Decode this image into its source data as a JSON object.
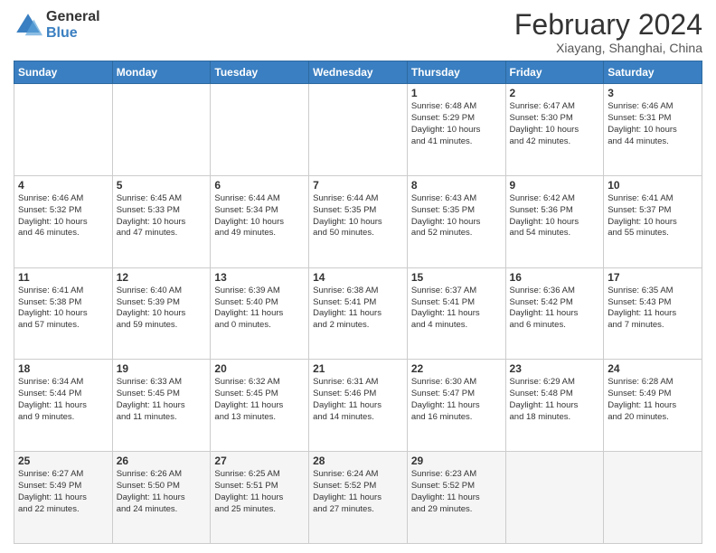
{
  "logo": {
    "general": "General",
    "blue": "Blue"
  },
  "title": "February 2024",
  "subtitle": "Xiayang, Shanghai, China",
  "days_header": [
    "Sunday",
    "Monday",
    "Tuesday",
    "Wednesday",
    "Thursday",
    "Friday",
    "Saturday"
  ],
  "weeks": [
    [
      {
        "day": "",
        "info": ""
      },
      {
        "day": "",
        "info": ""
      },
      {
        "day": "",
        "info": ""
      },
      {
        "day": "",
        "info": ""
      },
      {
        "day": "1",
        "info": "Sunrise: 6:48 AM\nSunset: 5:29 PM\nDaylight: 10 hours\nand 41 minutes."
      },
      {
        "day": "2",
        "info": "Sunrise: 6:47 AM\nSunset: 5:30 PM\nDaylight: 10 hours\nand 42 minutes."
      },
      {
        "day": "3",
        "info": "Sunrise: 6:46 AM\nSunset: 5:31 PM\nDaylight: 10 hours\nand 44 minutes."
      }
    ],
    [
      {
        "day": "4",
        "info": "Sunrise: 6:46 AM\nSunset: 5:32 PM\nDaylight: 10 hours\nand 46 minutes."
      },
      {
        "day": "5",
        "info": "Sunrise: 6:45 AM\nSunset: 5:33 PM\nDaylight: 10 hours\nand 47 minutes."
      },
      {
        "day": "6",
        "info": "Sunrise: 6:44 AM\nSunset: 5:34 PM\nDaylight: 10 hours\nand 49 minutes."
      },
      {
        "day": "7",
        "info": "Sunrise: 6:44 AM\nSunset: 5:35 PM\nDaylight: 10 hours\nand 50 minutes."
      },
      {
        "day": "8",
        "info": "Sunrise: 6:43 AM\nSunset: 5:35 PM\nDaylight: 10 hours\nand 52 minutes."
      },
      {
        "day": "9",
        "info": "Sunrise: 6:42 AM\nSunset: 5:36 PM\nDaylight: 10 hours\nand 54 minutes."
      },
      {
        "day": "10",
        "info": "Sunrise: 6:41 AM\nSunset: 5:37 PM\nDaylight: 10 hours\nand 55 minutes."
      }
    ],
    [
      {
        "day": "11",
        "info": "Sunrise: 6:41 AM\nSunset: 5:38 PM\nDaylight: 10 hours\nand 57 minutes."
      },
      {
        "day": "12",
        "info": "Sunrise: 6:40 AM\nSunset: 5:39 PM\nDaylight: 10 hours\nand 59 minutes."
      },
      {
        "day": "13",
        "info": "Sunrise: 6:39 AM\nSunset: 5:40 PM\nDaylight: 11 hours\nand 0 minutes."
      },
      {
        "day": "14",
        "info": "Sunrise: 6:38 AM\nSunset: 5:41 PM\nDaylight: 11 hours\nand 2 minutes."
      },
      {
        "day": "15",
        "info": "Sunrise: 6:37 AM\nSunset: 5:41 PM\nDaylight: 11 hours\nand 4 minutes."
      },
      {
        "day": "16",
        "info": "Sunrise: 6:36 AM\nSunset: 5:42 PM\nDaylight: 11 hours\nand 6 minutes."
      },
      {
        "day": "17",
        "info": "Sunrise: 6:35 AM\nSunset: 5:43 PM\nDaylight: 11 hours\nand 7 minutes."
      }
    ],
    [
      {
        "day": "18",
        "info": "Sunrise: 6:34 AM\nSunset: 5:44 PM\nDaylight: 11 hours\nand 9 minutes."
      },
      {
        "day": "19",
        "info": "Sunrise: 6:33 AM\nSunset: 5:45 PM\nDaylight: 11 hours\nand 11 minutes."
      },
      {
        "day": "20",
        "info": "Sunrise: 6:32 AM\nSunset: 5:45 PM\nDaylight: 11 hours\nand 13 minutes."
      },
      {
        "day": "21",
        "info": "Sunrise: 6:31 AM\nSunset: 5:46 PM\nDaylight: 11 hours\nand 14 minutes."
      },
      {
        "day": "22",
        "info": "Sunrise: 6:30 AM\nSunset: 5:47 PM\nDaylight: 11 hours\nand 16 minutes."
      },
      {
        "day": "23",
        "info": "Sunrise: 6:29 AM\nSunset: 5:48 PM\nDaylight: 11 hours\nand 18 minutes."
      },
      {
        "day": "24",
        "info": "Sunrise: 6:28 AM\nSunset: 5:49 PM\nDaylight: 11 hours\nand 20 minutes."
      }
    ],
    [
      {
        "day": "25",
        "info": "Sunrise: 6:27 AM\nSunset: 5:49 PM\nDaylight: 11 hours\nand 22 minutes."
      },
      {
        "day": "26",
        "info": "Sunrise: 6:26 AM\nSunset: 5:50 PM\nDaylight: 11 hours\nand 24 minutes."
      },
      {
        "day": "27",
        "info": "Sunrise: 6:25 AM\nSunset: 5:51 PM\nDaylight: 11 hours\nand 25 minutes."
      },
      {
        "day": "28",
        "info": "Sunrise: 6:24 AM\nSunset: 5:52 PM\nDaylight: 11 hours\nand 27 minutes."
      },
      {
        "day": "29",
        "info": "Sunrise: 6:23 AM\nSunset: 5:52 PM\nDaylight: 11 hours\nand 29 minutes."
      },
      {
        "day": "",
        "info": ""
      },
      {
        "day": "",
        "info": ""
      }
    ]
  ]
}
